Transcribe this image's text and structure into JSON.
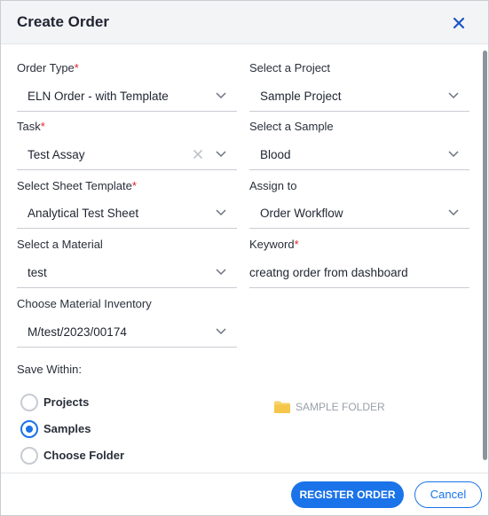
{
  "dialog": {
    "title": "Create Order",
    "close_icon": "close-icon",
    "accent_color": "#1a73e8",
    "required_color": "#e02424"
  },
  "fields": {
    "order_type": {
      "label": "Order Type",
      "required_mark": "*",
      "value": "ELN Order - with Template"
    },
    "project": {
      "label": "Select a Project",
      "value": "Sample Project"
    },
    "task": {
      "label": "Task",
      "required_mark": "*",
      "value": "Test Assay"
    },
    "sample": {
      "label": "Select a Sample",
      "value": "Blood"
    },
    "sheet_template": {
      "label": "Select Sheet Template",
      "required_mark": "*",
      "value": "Analytical Test Sheet"
    },
    "assign_to": {
      "label": "Assign to",
      "value": "Order Workflow"
    },
    "material": {
      "label": "Select a Material",
      "value": "test"
    },
    "keyword": {
      "label": "Keyword",
      "required_mark": "*",
      "value": "creatng order from dashboard"
    },
    "material_inventory": {
      "label": "Choose Material Inventory",
      "value": "M/test/2023/00174"
    }
  },
  "save_within": {
    "label": "Save Within:",
    "options": [
      "Projects",
      "Samples",
      "Choose Folder"
    ],
    "selected": "Samples",
    "folder_label": "SAMPLE FOLDER",
    "folder_icon": "folder-icon"
  },
  "footer": {
    "register_label": "REGISTER ORDER",
    "cancel_label": "Cancel"
  }
}
